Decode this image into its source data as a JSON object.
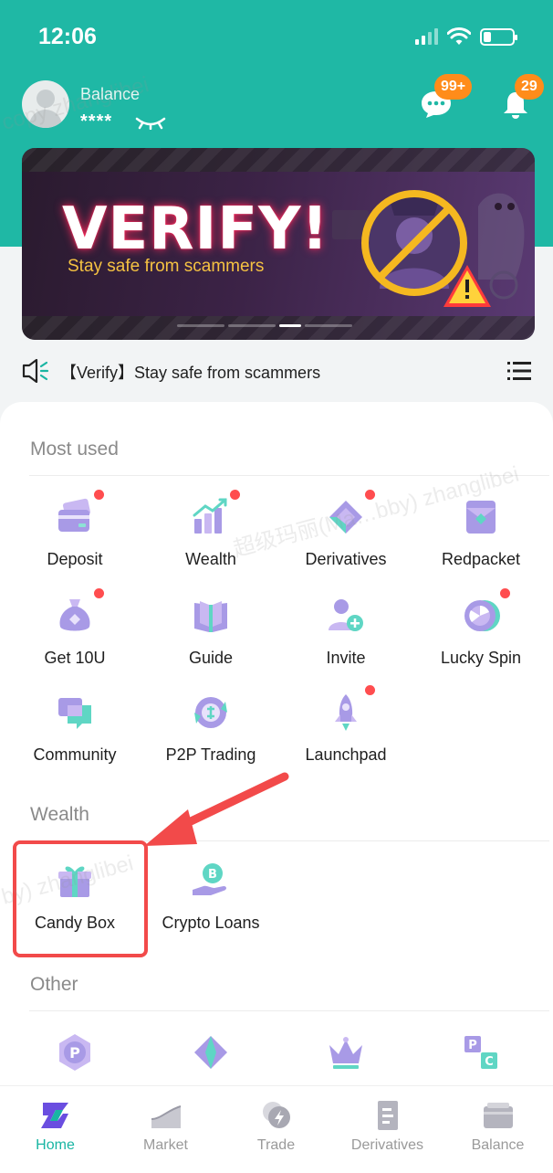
{
  "status": {
    "time": "12:06"
  },
  "header": {
    "balance_label": "Balance",
    "balance_value": "****",
    "messages_badge": "99+",
    "notifications_badge": "29"
  },
  "banner": {
    "title": "VERIFY!",
    "subtitle": "Stay safe from scammers",
    "active_slide": 3,
    "slide_count": 4
  },
  "notice": {
    "text": "【Verify】Stay safe from scammers"
  },
  "sections": {
    "most_used": {
      "title": "Most used",
      "items": [
        {
          "label": "Deposit",
          "icon": "card-wallet-icon",
          "dot": true
        },
        {
          "label": "Wealth",
          "icon": "growth-chart-icon",
          "dot": true
        },
        {
          "label": "Derivatives",
          "icon": "diamond-chevron-icon",
          "dot": true
        },
        {
          "label": "Redpacket",
          "icon": "envelope-icon",
          "dot": false
        },
        {
          "label": "Get 10U",
          "icon": "money-bag-icon",
          "dot": true
        },
        {
          "label": "Guide",
          "icon": "book-icon",
          "dot": false
        },
        {
          "label": "Invite",
          "icon": "add-user-icon",
          "dot": false
        },
        {
          "label": "Lucky Spin",
          "icon": "spin-wheel-icon",
          "dot": true
        },
        {
          "label": "Community",
          "icon": "chat-bubbles-icon",
          "dot": false
        },
        {
          "label": "P2P Trading",
          "icon": "p2p-exchange-icon",
          "dot": false
        },
        {
          "label": "Launchpad",
          "icon": "rocket-icon",
          "dot": true
        }
      ]
    },
    "wealth": {
      "title": "Wealth",
      "items": [
        {
          "label": "Candy Box",
          "icon": "gift-box-icon"
        },
        {
          "label": "Crypto Loans",
          "icon": "coin-hand-icon"
        }
      ]
    },
    "other": {
      "title": "Other",
      "items": [
        {
          "label": "",
          "icon": "coin-p-icon"
        },
        {
          "label": "",
          "icon": "diamond-icon"
        },
        {
          "label": "",
          "icon": "crown-icon"
        },
        {
          "label": "",
          "icon": "pc-blocks-icon"
        }
      ]
    }
  },
  "tabs": [
    {
      "label": "Home",
      "active": true
    },
    {
      "label": "Market",
      "active": false
    },
    {
      "label": "Trade",
      "active": false
    },
    {
      "label": "Derivatives",
      "active": false
    },
    {
      "label": "Balance",
      "active": false
    }
  ],
  "watermarks": [
    "copy zhanglibei",
    "超级玛丽(Ma…bby) zhanglibei",
    "by) zhanglibei"
  ],
  "colors": {
    "brand": "#1fb8a5",
    "badge": "#ff8c1a",
    "dot": "#ff4d4f",
    "highlight": "#f24a4a",
    "banner_sub": "#f5c242"
  }
}
